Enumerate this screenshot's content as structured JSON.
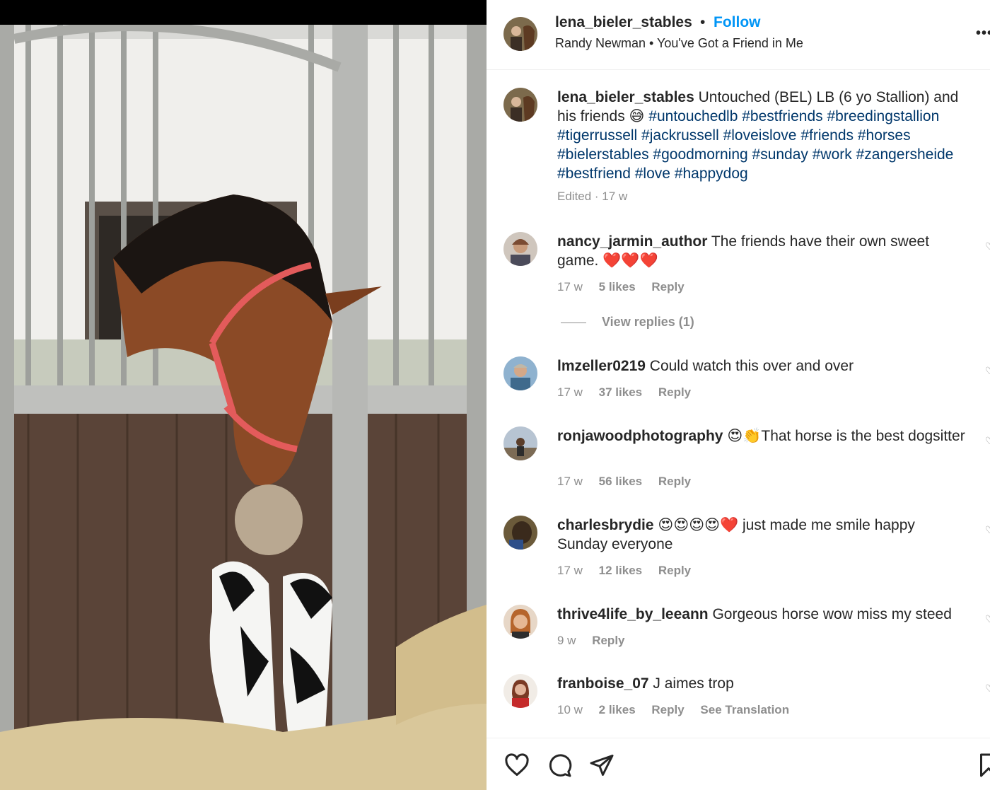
{
  "post": {
    "username": "lena_bieler_stables",
    "separator": "•",
    "follow_label": "Follow",
    "audio": "Randy Newman • You've Got a Friend in Me",
    "more_icon": "more-options-icon"
  },
  "caption": {
    "username": "lena_bieler_stables",
    "text": "Untouched (BEL) LB (6 yo Stallion) and his friends 😅",
    "hashtags": "#untouchedlb #bestfriends #breedingstallion #tigerrussell #jackrussell #loveislove #friends #horses #bielerstables #goodmorning #sunday #work #zangersheide #bestfriend #love #happydog",
    "meta": "Edited · 17 w"
  },
  "comments": [
    {
      "username": "nancy_jarmin_author",
      "text": "The friends have their own sweet game. ❤️❤️❤️",
      "age": "17 w",
      "likes": "5 likes",
      "reply": "Reply"
    },
    {
      "username": "lmzeller0219",
      "text": "Could watch this over and over",
      "age": "17 w",
      "likes": "37 likes",
      "reply": "Reply"
    },
    {
      "username": "ronjawoodphotography",
      "text": "😍👏That horse is the best dogsitter",
      "age": "17 w",
      "likes": "56 likes",
      "reply": "Reply"
    },
    {
      "username": "charlesbrydie",
      "text": "😍😍😍😍❤️ just made me smile happy Sunday everyone",
      "age": "17 w",
      "likes": "12 likes",
      "reply": "Reply"
    },
    {
      "username": "thrive4life_by_leeann",
      "text": "Gorgeous horse wow miss my steed",
      "age": "9 w",
      "likes": "",
      "reply": "Reply"
    },
    {
      "username": "franboise_07",
      "text": "J aimes trop",
      "age": "10 w",
      "likes": "2 likes",
      "reply": "Reply",
      "translate": "See Translation"
    }
  ],
  "view_replies": "View replies (1)",
  "actions": {
    "like_icon": "heart-icon",
    "comment_icon": "comment-icon",
    "share_icon": "share-icon",
    "save_icon": "bookmark-icon"
  },
  "colors": {
    "link": "#00376b",
    "follow": "#0095f6",
    "muted": "#8e8e8e",
    "text": "#262626"
  }
}
